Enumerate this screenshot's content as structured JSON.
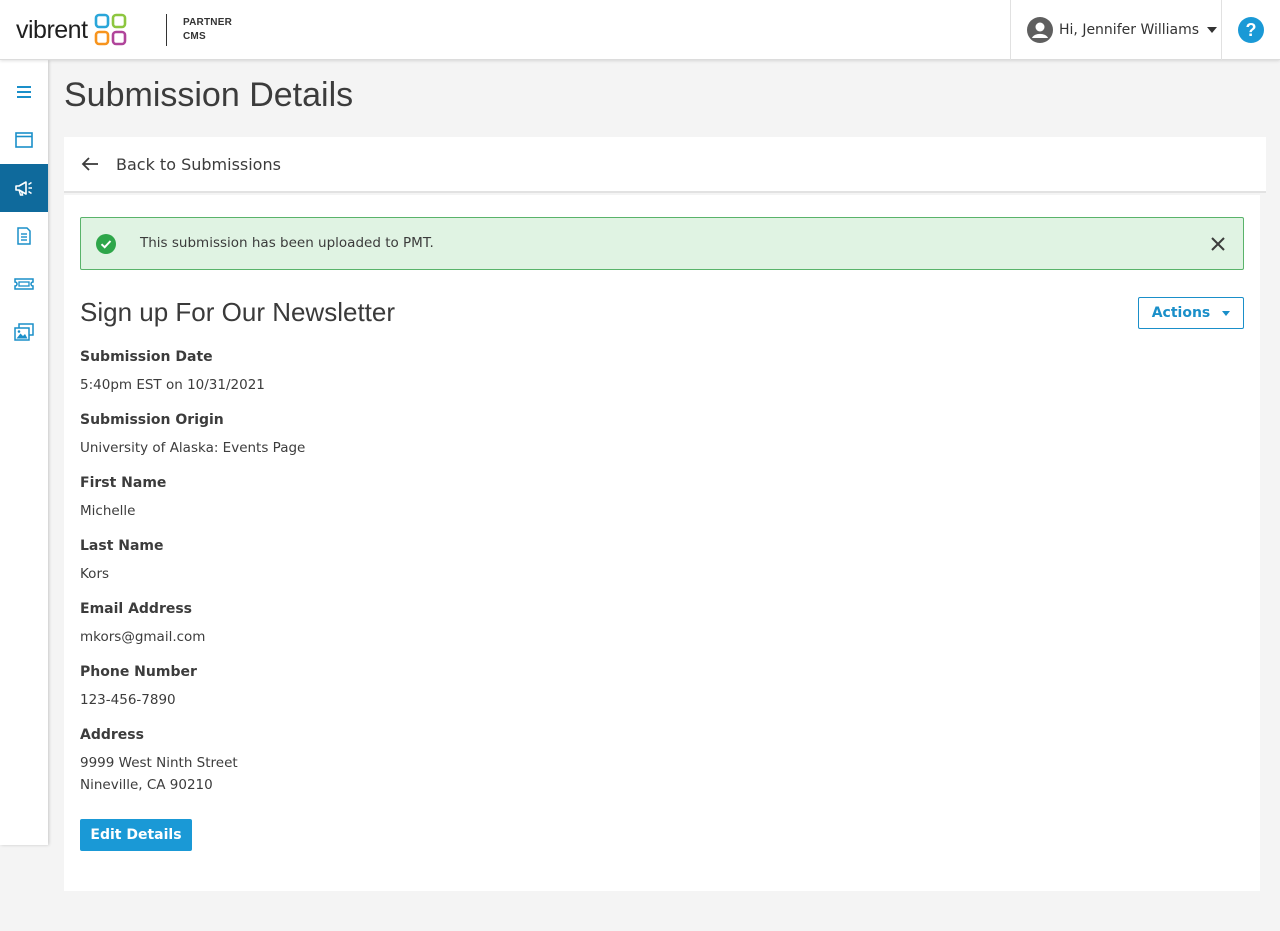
{
  "header": {
    "logo_text": "vibrent",
    "logo_sub_line1": "PARTNER",
    "logo_sub_line2": "CMS",
    "user_greeting": "Hi, Jennifer Williams",
    "help_label": "?"
  },
  "sidebar": {
    "items": [
      {
        "icon": "menu-icon",
        "active": false
      },
      {
        "icon": "window-icon",
        "active": false
      },
      {
        "icon": "megaphone-icon",
        "active": true
      },
      {
        "icon": "document-icon",
        "active": false
      },
      {
        "icon": "ticket-icon",
        "active": false
      },
      {
        "icon": "images-icon",
        "active": false
      }
    ]
  },
  "page": {
    "title": "Submission Details",
    "back_label": "Back to Submissions"
  },
  "alert": {
    "message": "This submission has been uploaded to PMT.",
    "type": "success"
  },
  "submission": {
    "form_title": "Sign up For Our Newsletter",
    "actions_label": "Actions",
    "fields": [
      {
        "label": "Submission Date",
        "value": "5:40pm EST on 10/31/2021"
      },
      {
        "label": "Submission Origin",
        "value": "University of Alaska: Events Page"
      },
      {
        "label": "First Name",
        "value": "Michelle"
      },
      {
        "label": "Last Name",
        "value": "Kors"
      },
      {
        "label": "Email Address",
        "value": "mkors@gmail.com"
      },
      {
        "label": "Phone Number",
        "value": "123-456-7890"
      },
      {
        "label": "Address",
        "value_line1": "9999 West Ninth Street",
        "value_line2": "Nineville, CA 90210"
      }
    ],
    "edit_label": "Edit Details"
  },
  "colors": {
    "primary": "#1a99d6",
    "sidebar_active": "#0f6a9c",
    "success_bg": "#e0f3e3",
    "success_border": "#59b36a",
    "success_icon": "#2ea64a"
  }
}
